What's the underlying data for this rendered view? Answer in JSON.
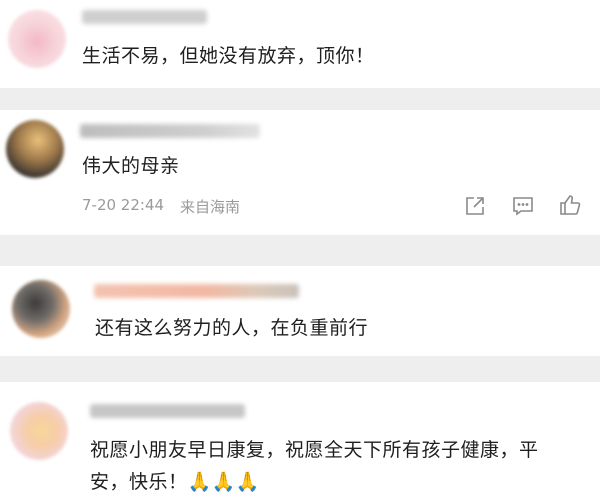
{
  "comments": [
    {
      "username": "user_one",
      "text": "生活不易，但她没有放弃，顶你！"
    },
    {
      "username": "user_two",
      "text": "伟大的母亲",
      "date": "7-20 22:44",
      "location": "来自海南",
      "actions": [
        "share-icon",
        "comment-icon",
        "like-icon"
      ]
    },
    {
      "username": "user_three",
      "text": "还有这么努力的人，在负重前行"
    },
    {
      "username": "user_four",
      "text_lines": [
        "祝愿小朋友早日康复，祝愿全天下所有孩子健康，平",
        "安，快乐！🙏🙏🙏"
      ]
    }
  ]
}
